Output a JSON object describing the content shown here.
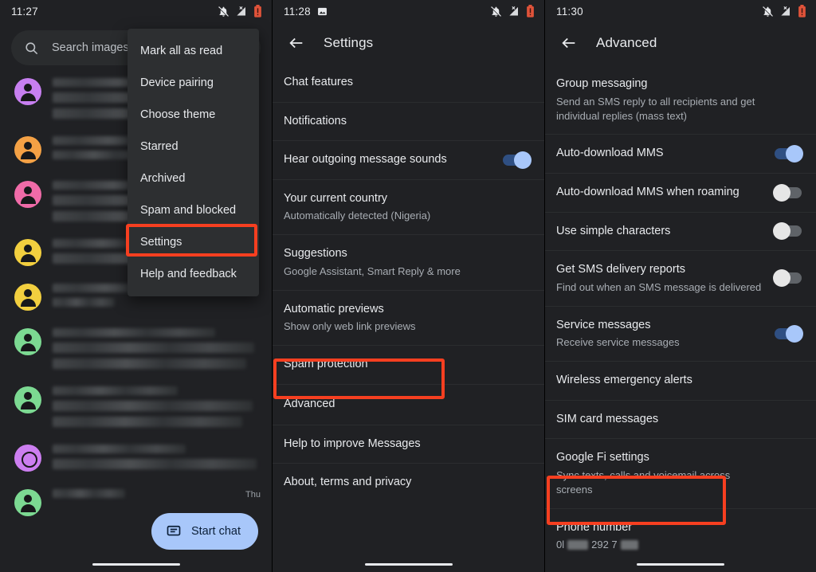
{
  "colors": {
    "bg": "#202124",
    "accent_blue": "#a8c7fa",
    "highlight_red": "#f63f20",
    "text_primary": "#e8eaed",
    "text_secondary": "#a8adb3"
  },
  "left_panel": {
    "statusbar": {
      "time": "11:27",
      "icons": [
        "notifications-off-icon",
        "signal-no-service-icon",
        "battery-alert-icon"
      ]
    },
    "search": {
      "placeholder": "Search images an",
      "icon": "search-icon"
    },
    "menu": {
      "items": [
        {
          "label": "Mark all as read"
        },
        {
          "label": "Device pairing"
        },
        {
          "label": "Choose theme"
        },
        {
          "label": "Starred"
        },
        {
          "label": "Archived"
        },
        {
          "label": "Spam and blocked"
        },
        {
          "label": "Settings",
          "highlighted": true
        },
        {
          "label": "Help and feedback"
        }
      ]
    },
    "conversations": [
      {
        "avatar_color": "#c77ff0",
        "avatar_style": "person",
        "lines": 2,
        "time": ""
      },
      {
        "avatar_color": "#f4a145",
        "avatar_style": "person",
        "lines": 2,
        "time": ""
      },
      {
        "avatar_color": "#f06ba8",
        "avatar_style": "person",
        "lines": 2,
        "time": ""
      },
      {
        "avatar_color": "#f2cf3f",
        "avatar_style": "person",
        "lines": 2,
        "time": ""
      },
      {
        "avatar_color": "#f2cf3f",
        "avatar_style": "person",
        "lines": 2,
        "time": ""
      },
      {
        "avatar_color": "#7cd992",
        "avatar_style": "person",
        "lines": 3,
        "time": ""
      },
      {
        "avatar_color": "#7cd992",
        "avatar_style": "person",
        "lines": 3,
        "time": ""
      },
      {
        "avatar_color": "#cc7ef0",
        "avatar_style": "ring",
        "lines": 2,
        "time": ""
      },
      {
        "avatar_color": "#7cd992",
        "avatar_style": "person",
        "lines": 2,
        "time": "Thu"
      }
    ],
    "fab": {
      "label": "Start chat",
      "icon": "message-icon"
    }
  },
  "mid_panel": {
    "statusbar": {
      "time": "11:28",
      "icons": [
        "image-icon",
        "notifications-off-icon",
        "signal-no-service-icon",
        "battery-alert-icon"
      ]
    },
    "toolbar": {
      "title": "Settings",
      "back_icon": "back-arrow-icon"
    },
    "rows": [
      {
        "title": "Chat features"
      },
      {
        "title": "Notifications"
      },
      {
        "title": "Hear outgoing message sounds",
        "toggle": "on"
      },
      {
        "title": "Your current country",
        "subtitle": "Automatically detected (Nigeria)"
      },
      {
        "title": "Suggestions",
        "subtitle": "Google Assistant, Smart Reply & more"
      },
      {
        "title": "Automatic previews",
        "subtitle": "Show only web link previews"
      },
      {
        "title": "Spam protection"
      },
      {
        "title": "Advanced",
        "highlighted": true
      },
      {
        "title": "Help to improve Messages"
      },
      {
        "title": "About, terms and privacy"
      }
    ]
  },
  "right_panel": {
    "statusbar": {
      "time": "11:30",
      "icons": [
        "notifications-off-icon",
        "signal-no-service-icon",
        "battery-alert-icon"
      ]
    },
    "toolbar": {
      "title": "Advanced",
      "back_icon": "back-arrow-icon"
    },
    "rows": [
      {
        "title": "Group messaging",
        "subtitle": "Send an SMS reply to all recipients and get individual replies (mass text)"
      },
      {
        "title": "Auto-download MMS",
        "toggle": "on"
      },
      {
        "title": "Auto-download MMS when roaming",
        "toggle": "off"
      },
      {
        "title": "Use simple characters",
        "toggle": "off"
      },
      {
        "title": "Get SMS delivery reports",
        "subtitle": "Find out when an SMS message is delivered",
        "toggle": "off"
      },
      {
        "title": "Service messages",
        "subtitle": "Receive service messages",
        "toggle": "on"
      },
      {
        "title": "Wireless emergency alerts"
      },
      {
        "title": "SIM card messages"
      },
      {
        "title": "Google Fi settings",
        "subtitle": "Sync texts, calls and voicemail across screens"
      },
      {
        "title": "Phone number",
        "subtitle_parts": [
          "0l",
          "292 7"
        ],
        "highlighted": true
      }
    ]
  }
}
